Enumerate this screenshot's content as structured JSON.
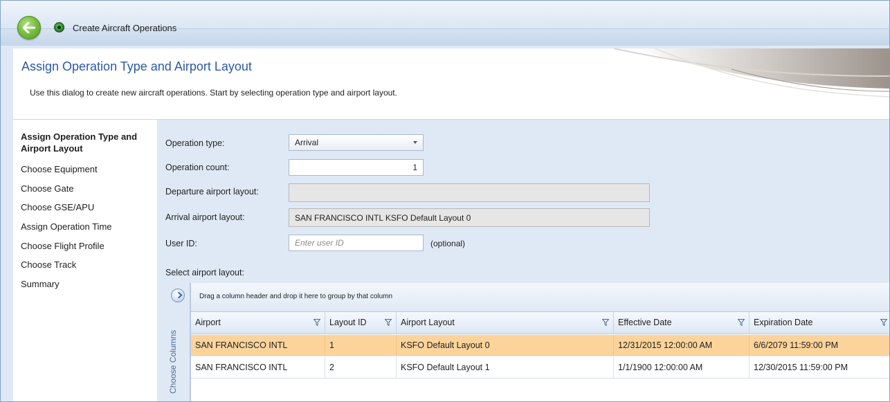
{
  "window": {
    "title": "Create Aircraft Operations"
  },
  "header": {
    "title": "Assign Operation Type and Airport Layout",
    "description": "Use this dialog to create new aircraft operations. Start by selecting operation type and airport layout."
  },
  "nav": {
    "items": [
      {
        "label": "Assign Operation Type and Airport Layout",
        "active": true
      },
      {
        "label": "Choose Equipment"
      },
      {
        "label": "Choose Gate"
      },
      {
        "label": "Choose GSE/APU"
      },
      {
        "label": "Assign Operation Time"
      },
      {
        "label": "Choose Flight Profile"
      },
      {
        "label": "Choose Track"
      },
      {
        "label": "Summary"
      }
    ]
  },
  "form": {
    "operation_type_label": "Operation type:",
    "operation_type_value": "Arrival",
    "operation_count_label": "Operation count:",
    "operation_count_value": "1",
    "departure_layout_label": "Departure airport layout:",
    "departure_layout_value": "",
    "arrival_layout_label": "Arrival airport layout:",
    "arrival_layout_value": "SAN FRANCISCO INTL KSFO Default Layout 0",
    "user_id_label": "User ID:",
    "user_id_placeholder": "Enter user ID",
    "user_id_optional": "(optional)",
    "select_layout_label": "Select airport layout:"
  },
  "grid": {
    "choose_columns_label": "Choose Columns",
    "group_hint": "Drag a column header and drop it here to group by that column",
    "columns": [
      "Airport",
      "Layout ID",
      "Airport Layout",
      "Effective Date",
      "Expiration Date"
    ],
    "rows": [
      {
        "airport": "SAN FRANCISCO INTL",
        "layout_id": "1",
        "layout": "KSFO Default Layout 0",
        "effective": "12/31/2015 12:00:00 AM",
        "expiration": "6/6/2079 11:59:00 PM",
        "selected": true
      },
      {
        "airport": "SAN FRANCISCO INTL",
        "layout_id": "2",
        "layout": "KSFO Default Layout 1",
        "effective": "1/1/1900 12:00:00 AM",
        "expiration": "12/30/2015 11:59:00 PM",
        "selected": false
      }
    ]
  },
  "colors": {
    "accent_title": "#2b5aa3",
    "selected_row": "#fcd49b",
    "panel_bg": "#dfe9f5"
  }
}
